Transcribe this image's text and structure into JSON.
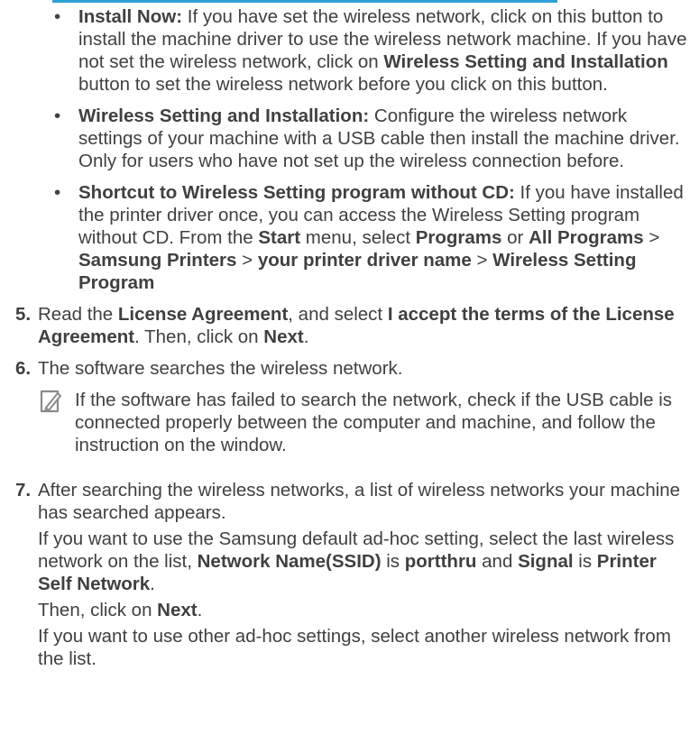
{
  "accent_color": "#2e9fd6",
  "bullets": [
    {
      "bullet_char": "•",
      "title": "Install Now:",
      "text_a": " If you have set the wireless network, click on this button to install the machine driver to use the wireless network machine. If you have not set the wireless network, click on ",
      "bold_a": "Wireless Setting and Installation",
      "text_b": " button to set the wireless network before you click on this button."
    },
    {
      "bullet_char": "•",
      "title": "Wireless Setting and Installation:",
      "text_a": " Configure the wireless network settings of your machine with a USB cable then install the machine driver. Only for users who have not set up the wireless connection before."
    },
    {
      "bullet_char": "•",
      "title": "Shortcut to Wireless Setting program without CD:",
      "text_a": " If you have installed the printer driver once, you can access the Wireless Setting program without CD. From the ",
      "bold_a": "Start",
      "text_b": " menu, select ",
      "bold_b": "Programs",
      "text_c": " or ",
      "bold_c": "All Programs",
      "text_d": " > ",
      "bold_d": "Samsung Printers",
      "text_e": " > ",
      "bold_e": "your printer driver name",
      "text_f": " > ",
      "bold_f": "Wireless Setting Program"
    }
  ],
  "steps": [
    {
      "number": "5.",
      "text_a": "Read the ",
      "bold_a": "License Agreement",
      "text_b": ", and select ",
      "bold_b": "I accept the terms of the License Agreement",
      "text_c": ". Then, click on ",
      "bold_c": "Next",
      "text_d": "."
    },
    {
      "number": "6.",
      "text_a": "The software searches the wireless network.",
      "note_icon": "note-pencil-icon",
      "note_text": "If the software has failed to search the network, check if the USB cable is connected properly between the computer and machine, and follow the instruction on the window."
    },
    {
      "number": "7.",
      "text_a": "After searching the wireless networks, a list of wireless networks your machine has searched appears.",
      "p2_a": "If you want to use the Samsung default ad-hoc setting, select the last wireless network on the list, ",
      "p2_bold_a": "Network Name(SSID)",
      "p2_b": " is ",
      "p2_bold_b": "portthru",
      "p2_c": " and ",
      "p2_bold_c": "Signal",
      "p2_d": " is ",
      "p2_bold_d": "Printer Self Network",
      "p2_e": ".",
      "p3_a": "Then, click on ",
      "p3_bold_a": "Next",
      "p3_b": ".",
      "p4_a": "If you want to use other ad-hoc settings, select another wireless network from the list."
    }
  ]
}
